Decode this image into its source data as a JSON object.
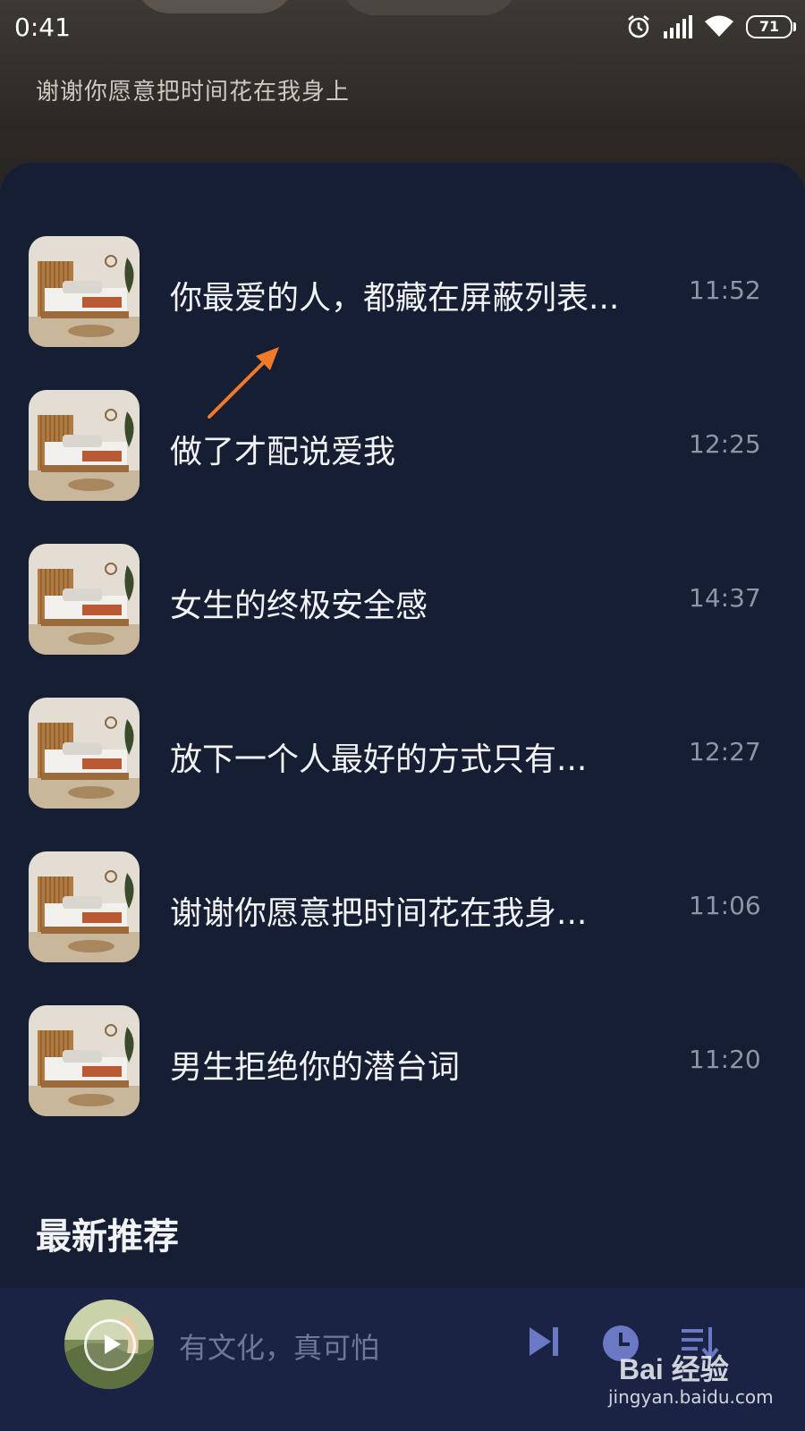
{
  "status_bar": {
    "time": "0:41",
    "battery": "71",
    "icons": [
      "alarm-icon",
      "signal-icon",
      "wifi-icon",
      "battery-icon"
    ]
  },
  "header": {
    "subtitle": "谢谢你愿意把时间花在我身上"
  },
  "list": {
    "items": [
      {
        "title": "你最爱的人，都藏在屏蔽列表...",
        "duration": "11:52"
      },
      {
        "title": "做了才配说爱我",
        "duration": "12:25"
      },
      {
        "title": "女生的终极安全感",
        "duration": "14:37"
      },
      {
        "title": "放下一个人最好的方式只有...",
        "duration": "12:27"
      },
      {
        "title": "谢谢你愿意把时间花在我身...",
        "duration": "11:06"
      },
      {
        "title": "男生拒绝你的潜台词",
        "duration": "11:20"
      }
    ]
  },
  "section": {
    "title": "最新推荐"
  },
  "player": {
    "now_playing": "有文化，真可怕",
    "controls": [
      "next-icon",
      "timer-icon",
      "playlist-icon"
    ]
  },
  "watermark": {
    "logo": "Bai 经验",
    "url": "jingyan.baidu.com"
  },
  "colors": {
    "background": "#161e33",
    "player_bar": "#1b2345",
    "annotation_arrow": "#f07a2a",
    "control_icons": "#6b78c4"
  }
}
